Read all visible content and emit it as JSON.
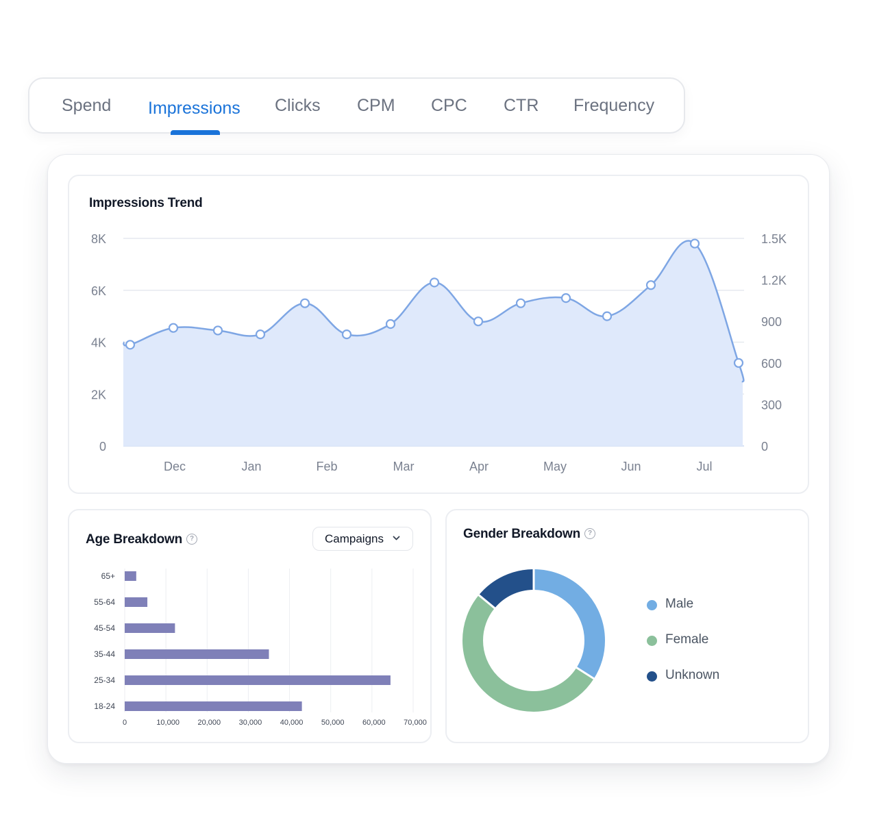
{
  "tabs": {
    "items": [
      {
        "label": "Spend"
      },
      {
        "label": "Impressions"
      },
      {
        "label": "Clicks"
      },
      {
        "label": "CPM"
      },
      {
        "label": "CPC"
      },
      {
        "label": "CTR"
      },
      {
        "label": "Frequency"
      }
    ],
    "active_index": 1,
    "active_color": "#1a73d9"
  },
  "trend": {
    "title": "Impressions Trend"
  },
  "age": {
    "title": "Age Breakdown",
    "dropdown_label": "Campaigns"
  },
  "gender": {
    "title": "Gender Breakdown"
  },
  "chart_data": [
    {
      "type": "area",
      "title": "Impressions Trend",
      "y_left_ticks": [
        "0",
        "2K",
        "4K",
        "6K",
        "8K"
      ],
      "y_right_ticks": [
        "0",
        "300",
        "600",
        "900",
        "1.2K",
        "1.5K"
      ],
      "x_ticks": [
        "Dec",
        "Jan",
        "Feb",
        "Mar",
        "Apr",
        "May",
        "Jun",
        "Jul"
      ],
      "ylim": [
        0,
        8000
      ],
      "y_right_lim": [
        0,
        1500
      ],
      "grid": true,
      "color": "#7ea6e4",
      "fill": "#dfe9fb",
      "x": [
        "Nov 22",
        "Dec 9",
        "Dec 26",
        "Jan 11",
        "Jan 28",
        "Feb 15",
        "Mar 3",
        "Mar 16",
        "Apr 2",
        "Apr 19",
        "May 8",
        "May 25",
        "Jun 8",
        "Jun 26",
        "Jul 23"
      ],
      "values": [
        3900,
        4550,
        4450,
        4300,
        5500,
        4300,
        4700,
        6300,
        4800,
        5500,
        5700,
        5000,
        6200,
        7800,
        3200
      ]
    },
    {
      "type": "bar",
      "orientation": "horizontal",
      "title": "Age Breakdown",
      "categories": [
        "65+",
        "55-64",
        "45-54",
        "35-44",
        "25-34",
        "18-24"
      ],
      "values": [
        2800,
        5500,
        12200,
        35000,
        64500,
        43000
      ],
      "x_ticks": [
        "0",
        "10,000",
        "20,000",
        "30,000",
        "40,000",
        "50,000",
        "60,000",
        "70,000"
      ],
      "xlim": [
        0,
        70000
      ],
      "color": "#7f80b8",
      "grid": true
    },
    {
      "type": "pie",
      "style": "donut",
      "title": "Gender Breakdown",
      "legend_position": "right",
      "slices": [
        {
          "name": "Male",
          "value": 34,
          "color": "#72ade3"
        },
        {
          "name": "Female",
          "value": 52,
          "color": "#8bc09b"
        },
        {
          "name": "Unknown",
          "value": 14,
          "color": "#23508a"
        }
      ]
    }
  ]
}
